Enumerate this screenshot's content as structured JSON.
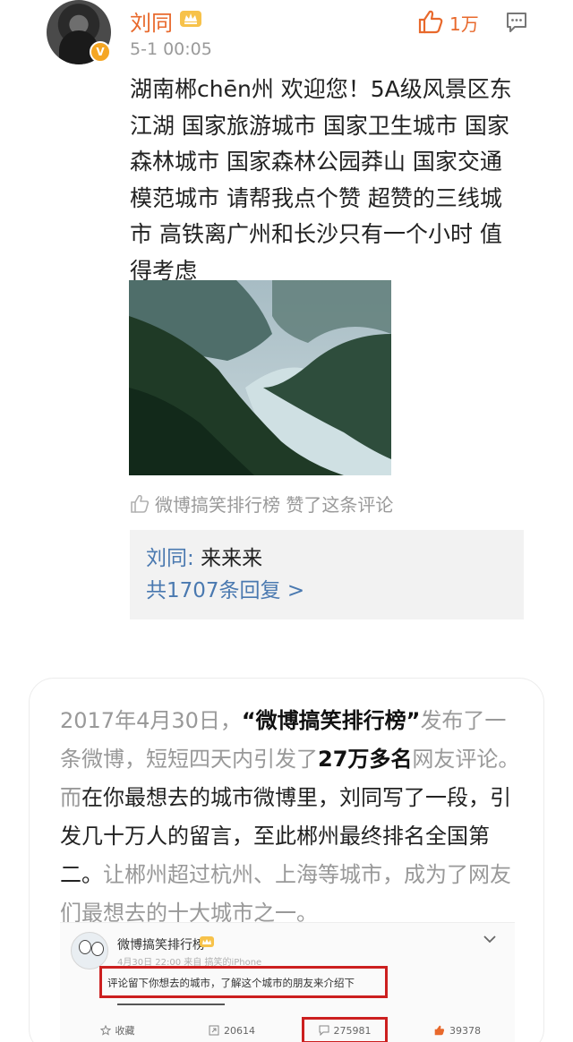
{
  "comment": {
    "username": "刘同",
    "timestamp": "5-1 00:05",
    "like_count": "1万",
    "verified_badge": "V",
    "icons": [
      "vip-crown-icon",
      "thumbs-up-icon",
      "reply-icon"
    ],
    "text": "湖南郴chēn州 欢迎您！5A级风景区东江湖 国家旅游城市 国家卫生城市 国家森林城市 国家森林公园莽山 国家交通模范城市 请帮我点个赞 超赞的三线城市 高铁离广州和长沙只有一个小时 值得考虑",
    "liked_by": "微博搞笑排行榜 赞了这条评论",
    "reply": {
      "author": "刘同",
      "separator": ": ",
      "text": "来来来",
      "count_text": "共1707条回复 >"
    }
  },
  "article": {
    "p1": "2017年4月30日，",
    "q1": "“微博搞笑排行榜”",
    "p2": "发布了一条微博，短短四天内引发了",
    "b1": "27万多名",
    "p3": "网友评论。而",
    "dark1": "在你最想去的城市微博里，刘同写了一段，引发几十万人的留言，至此郴州最终排名全国第二。",
    "p4": "让郴州超过杭州、上海等城市，成为了网友们最想去的十大城市之一。"
  },
  "embed": {
    "name": "微博搞笑排行榜",
    "meta": "4月30日 22:00 来自 搞笑的iPhone",
    "quote": "评论留下你想去的城市，了解这个城市的朋友来介绍下",
    "actions": [
      {
        "icon": "star-icon",
        "label": "收藏"
      },
      {
        "icon": "repost-icon",
        "label": "20614"
      },
      {
        "icon": "comment-icon",
        "label": "275981"
      },
      {
        "icon": "thumbs-up-icon",
        "label": "39378"
      }
    ]
  },
  "colors": {
    "username": "#e8692c",
    "link": "#4a79b0",
    "highlight_box": "#cc1f1f"
  }
}
